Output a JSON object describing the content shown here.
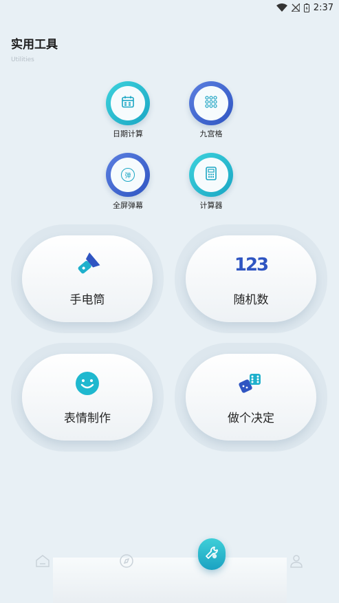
{
  "status_bar": {
    "time": "2:37"
  },
  "header": {
    "title": "实用工具",
    "subtitle": "Utilities"
  },
  "quick_tools": [
    {
      "label": "日期计算",
      "icon": "calendar-icon",
      "ring_color": "#2bbfd3"
    },
    {
      "label": "九宫格",
      "icon": "grid-icon",
      "ring_color": "#3d63cf"
    },
    {
      "label": "全屏弹幕",
      "icon": "danmaku-icon",
      "ring_color": "#3d63cf",
      "glyph": "弹"
    },
    {
      "label": "计算器",
      "icon": "calculator-icon",
      "ring_color": "#2bbfd3"
    }
  ],
  "feature_cards": [
    {
      "label": "手电筒",
      "icon": "flashlight-icon"
    },
    {
      "label": "随机数",
      "icon": "random-number-icon",
      "glyph": "123"
    },
    {
      "label": "表情制作",
      "icon": "smiley-icon"
    },
    {
      "label": "做个决定",
      "icon": "dice-icon"
    }
  ],
  "bottom_nav": [
    {
      "name": "home",
      "icon": "home-icon",
      "active": false
    },
    {
      "name": "discover",
      "icon": "compass-icon",
      "active": false
    },
    {
      "name": "tools",
      "icon": "wrench-icon",
      "active": true
    },
    {
      "name": "profile",
      "icon": "user-icon",
      "active": false
    }
  ],
  "colors": {
    "accent_teal": "#2bbfd3",
    "accent_blue": "#3d63cf",
    "background": "#e8f0f5"
  }
}
